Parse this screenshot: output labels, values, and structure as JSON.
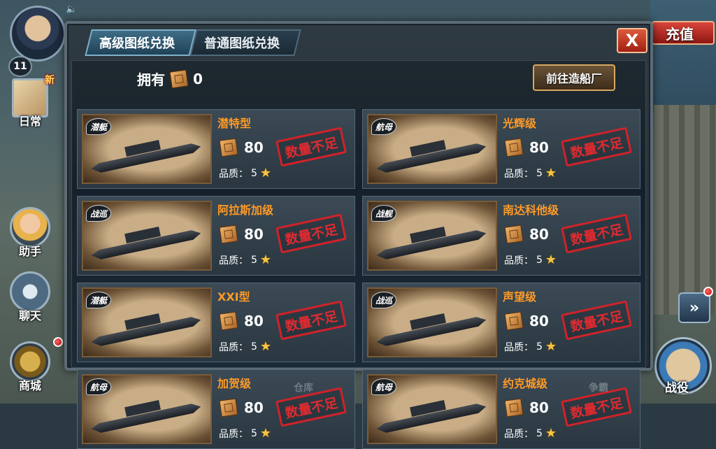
{
  "hud": {
    "level": "11",
    "new_tag": "新",
    "daily_label": "日常",
    "assistant_label": "助手",
    "chat_label": "聊天",
    "shop_label": "商城",
    "recharge_label": "充值",
    "battle_label": "战役",
    "forward_icon": "»",
    "speaker_icon": "🔈"
  },
  "dialog": {
    "tabs": [
      {
        "label": "高级图纸兑换",
        "active": true
      },
      {
        "label": "普通图纸兑换",
        "active": false
      }
    ],
    "close_label": "X",
    "owned_label": "拥有",
    "owned_count": "0",
    "goto_shipyard_label": "前往造船厂",
    "quality_label": "品质：",
    "insufficient_label": "数量不足",
    "background_labels": [
      "仓库",
      "争霸"
    ],
    "ships": [
      {
        "name": "潜特型",
        "badge": "潜艇",
        "cost": "80",
        "quality": "5"
      },
      {
        "name": "光辉级",
        "badge": "航母",
        "cost": "80",
        "quality": "5"
      },
      {
        "name": "阿拉斯加级",
        "badge": "战巡",
        "cost": "80",
        "quality": "5"
      },
      {
        "name": "南达科他级",
        "badge": "战舰",
        "cost": "80",
        "quality": "5"
      },
      {
        "name": "XXI型",
        "badge": "潜艇",
        "cost": "80",
        "quality": "5"
      },
      {
        "name": "声望级",
        "badge": "战巡",
        "cost": "80",
        "quality": "5"
      },
      {
        "name": "加贺级",
        "badge": "航母",
        "cost": "80",
        "quality": "5"
      },
      {
        "name": "约克城级",
        "badge": "航母",
        "cost": "80",
        "quality": "5"
      }
    ]
  }
}
